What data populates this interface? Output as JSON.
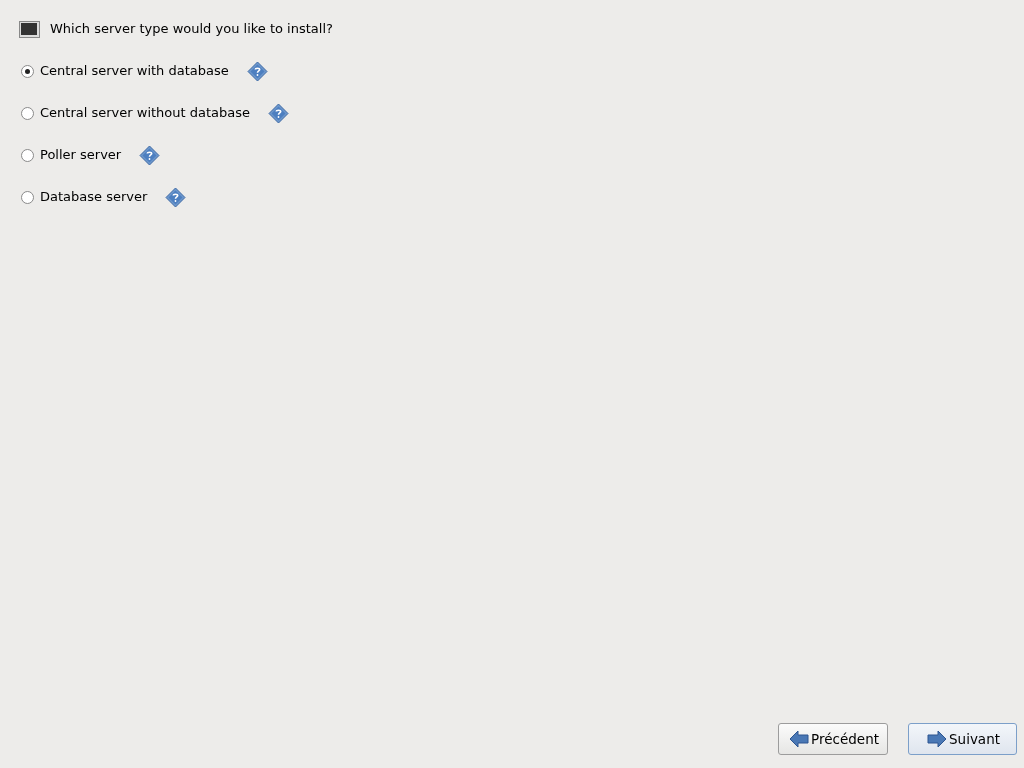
{
  "question": "Which server type would you like to install?",
  "options": [
    {
      "label": "Central server with database",
      "selected": true
    },
    {
      "label": "Central server without database",
      "selected": false
    },
    {
      "label": "Poller server",
      "selected": false
    },
    {
      "label": "Database server",
      "selected": false
    }
  ],
  "buttons": [
    {
      "label": "Précédent",
      "kind": "back",
      "focused": false
    },
    {
      "label": "Suivant",
      "kind": "next",
      "focused": true
    }
  ]
}
